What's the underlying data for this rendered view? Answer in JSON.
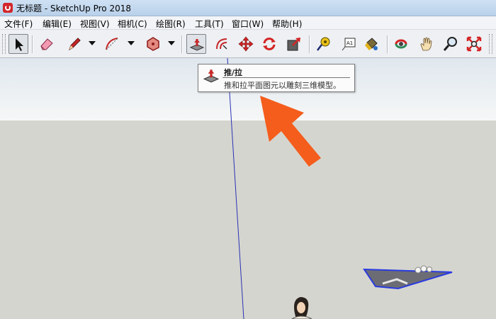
{
  "window": {
    "title": "无标题 - SketchUp Pro 2018"
  },
  "menu": [
    "文件(F)",
    "编辑(E)",
    "视图(V)",
    "相机(C)",
    "绘图(R)",
    "工具(T)",
    "窗口(W)",
    "帮助(H)"
  ],
  "toolbar": {
    "tools": [
      {
        "id": "select",
        "icon": "select-arrow-icon",
        "state": "pressed"
      },
      {
        "id": "eraser",
        "icon": "eraser-icon"
      },
      {
        "id": "pencil",
        "icon": "pencil-icon",
        "has_dropdown": true
      },
      {
        "id": "arc",
        "icon": "arc-icon",
        "has_dropdown": true
      },
      {
        "id": "shapes",
        "icon": "polygon-icon",
        "has_dropdown": true
      },
      {
        "id": "push_pull",
        "icon": "push-pull-icon",
        "state": "hover"
      },
      {
        "id": "offset",
        "icon": "offset-icon"
      },
      {
        "id": "move",
        "icon": "move-icon"
      },
      {
        "id": "rotate",
        "icon": "rotate-icon"
      },
      {
        "id": "scale",
        "icon": "scale-icon"
      },
      {
        "id": "tape_measure",
        "icon": "tape-measure-icon"
      },
      {
        "id": "text",
        "icon": "text-icon"
      },
      {
        "id": "paint_bucket",
        "icon": "paint-bucket-icon"
      },
      {
        "id": "orbit",
        "icon": "orbit-icon"
      },
      {
        "id": "pan",
        "icon": "pan-hand-icon"
      },
      {
        "id": "zoom",
        "icon": "zoom-icon"
      },
      {
        "id": "zoom_extents",
        "icon": "zoom-extents-icon"
      }
    ],
    "text_tool_label": "A1"
  },
  "tooltip": {
    "title": "推/拉",
    "description": "推和拉平面图元以雕刻三维模型。"
  },
  "colors": {
    "accent_red": "#d2262b",
    "annotation_arrow": "#f45d1c",
    "blue_axis": "#2832b4",
    "sky": "#eef1f3",
    "ground": "#d5d5cf"
  }
}
